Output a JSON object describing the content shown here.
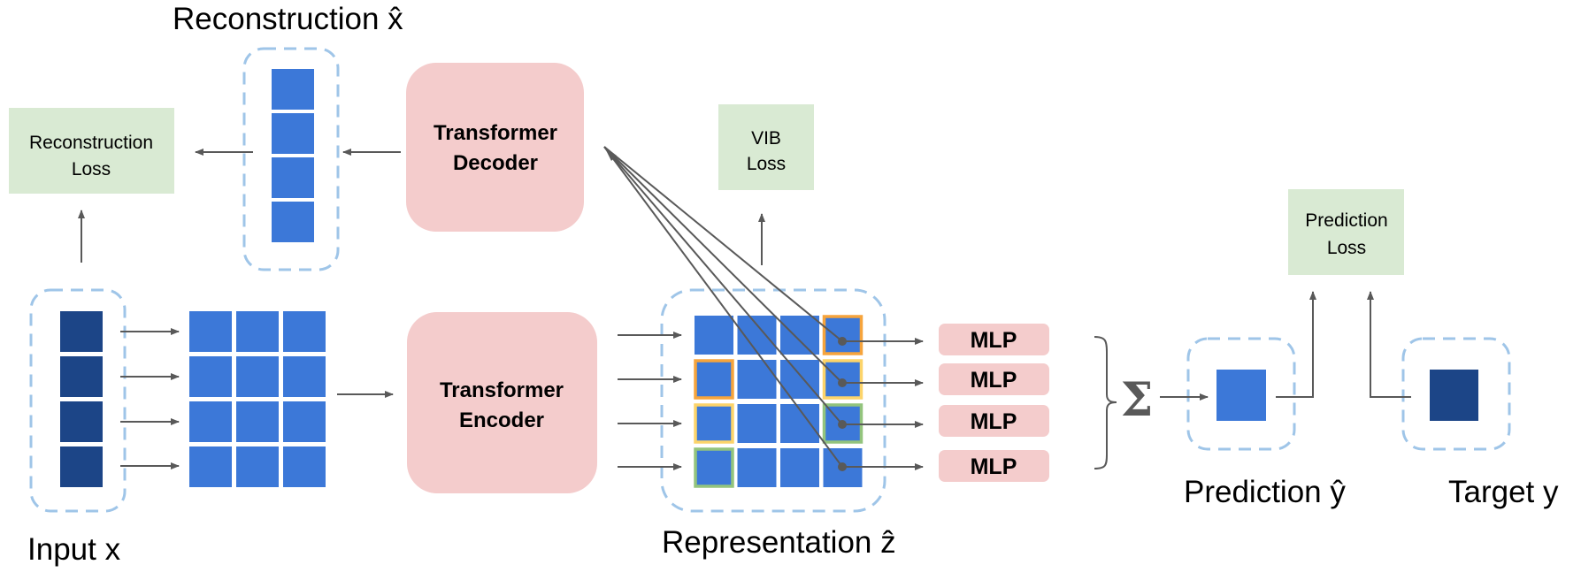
{
  "diagram": {
    "titles": {
      "reconstruction": "Reconstruction x̂",
      "input": "Input x",
      "representation": "Representation ẑ",
      "prediction": "Prediction ŷ",
      "target": "Target y"
    },
    "modules": {
      "decoder": [
        "Transformer",
        "Decoder"
      ],
      "encoder": [
        "Transformer",
        "Encoder"
      ],
      "mlp_label": "MLP",
      "mlp_count": 4,
      "sum_symbol": "Σ"
    },
    "losses": {
      "reconstruction": [
        "Reconstruction",
        "Loss"
      ],
      "vib": [
        "VIB",
        "Loss"
      ],
      "prediction": [
        "Prediction",
        "Loss"
      ]
    },
    "grid": {
      "input_tokens": 4,
      "embedding_rows": 4,
      "embedding_cols": 3,
      "representation_rows": 4,
      "representation_cols": 4,
      "highlights": [
        {
          "row": 0,
          "col": 3,
          "color": "#f6a43c"
        },
        {
          "row": 1,
          "col": 0,
          "color": "#f6a43c"
        },
        {
          "row": 1,
          "col": 3,
          "color": "#fcd46a"
        },
        {
          "row": 2,
          "col": 0,
          "color": "#fcd46a"
        },
        {
          "row": 2,
          "col": 3,
          "color": "#93c47d"
        },
        {
          "row": 3,
          "col": 0,
          "color": "#93c47d"
        }
      ]
    },
    "colors": {
      "cell_blue": "#3c78d8",
      "cell_dark": "#1c4587",
      "module_pink": "#f4cccc",
      "loss_green": "#d9ead3",
      "dashed_border": "#9fc5e8",
      "arrow": "#595959"
    }
  }
}
